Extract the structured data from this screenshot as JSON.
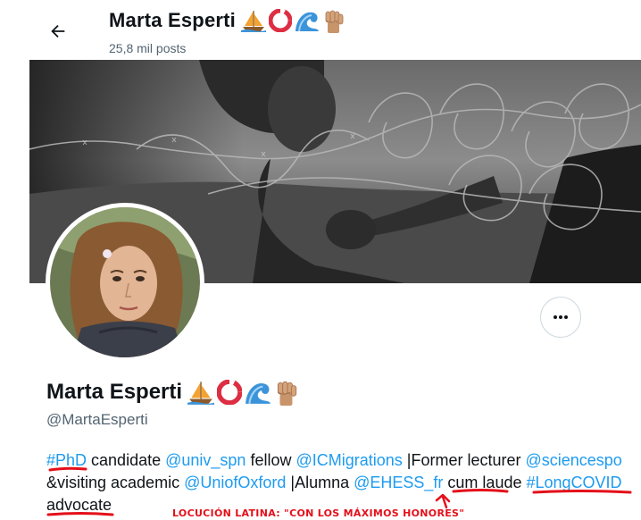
{
  "header": {
    "back_icon": "arrow-left-icon",
    "name": "Marta Esperti",
    "posts": "25,8 mil posts",
    "emojis": [
      "sailboat-icon",
      "lifebuoy-icon",
      "wave-icon",
      "raised-fist-icon"
    ]
  },
  "profile": {
    "display_name": "Marta Esperti",
    "handle": "@MartaEsperti",
    "more_icon": "more-horizontal-icon"
  },
  "bio": [
    {
      "text": "#PhD",
      "link": true
    },
    {
      "text": " candidate ",
      "link": false
    },
    {
      "text": "@univ_spn",
      "link": true
    },
    {
      "text": " fellow ",
      "link": false
    },
    {
      "text": "@ICMigrations",
      "link": true
    },
    {
      "text": " |Former lecturer ",
      "link": false
    },
    {
      "text": "@sciencespo",
      "link": true
    },
    {
      "text": " &visiting academic ",
      "link": false
    },
    {
      "text": "@UniofOxford",
      "link": true
    },
    {
      "text": " |Alumna ",
      "link": false
    },
    {
      "text": "@EHESS_fr",
      "link": true
    },
    {
      "text": " cum laude ",
      "link": false
    },
    {
      "text": "#LongCOVID",
      "link": true
    },
    {
      "text": " advocate",
      "link": false
    }
  ],
  "annotation": "LOCUCIÓN LATINA: \"CON LOS MÁXIMOS HONORES\"",
  "colors": {
    "link": "#1d9bf0",
    "secondary_text": "#536471",
    "annotation_red": "#e4101a"
  }
}
